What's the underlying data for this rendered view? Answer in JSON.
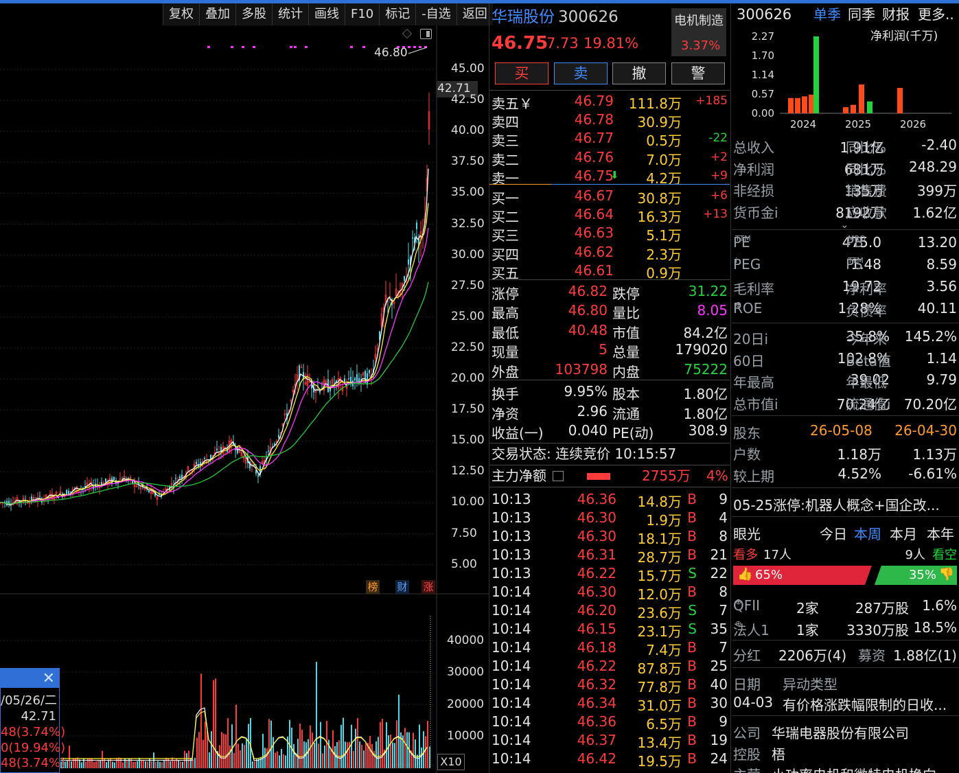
{
  "toolbar": [
    "复权",
    "叠加",
    "多股",
    "统计",
    "画线",
    "F10",
    "标记",
    "-自选",
    "返回"
  ],
  "chart": {
    "price_labels": [
      "45.00",
      "42.50",
      "40.00",
      "37.50",
      "35.00",
      "32.50",
      "30.00",
      "27.50",
      "25.00",
      "22.50",
      "20.00",
      "17.50",
      "15.00",
      "12.50",
      "10.00",
      "7.50",
      "5.00"
    ],
    "high_marker": "46.80",
    "current_price_tag": "42.71",
    "vol_labels": [
      "40000",
      "30000",
      "20000",
      "10000"
    ],
    "vol_unit": "X10",
    "badges": [
      "榜",
      "财",
      "涨"
    ],
    "tooltip": {
      "date": "/05/26/二",
      "price": "42.71",
      "l1": "48(3.74%)",
      "l2": "0(19.94%)",
      "l3": "48(3.74%)"
    }
  },
  "stock": {
    "name": "华瑞股份",
    "code": "300626",
    "price": "46.75",
    "change": "7.73",
    "pct": "19.81%",
    "sector": "电机制造",
    "sector_pct": "3.37%"
  },
  "actions": [
    "买",
    "卖",
    "撤",
    "警"
  ],
  "asks": [
    {
      "label": "卖五￥",
      "price": "46.79",
      "vol": "111.8万",
      "chg": "+185"
    },
    {
      "label": "卖四",
      "price": "46.78",
      "vol": "30.9万",
      "chg": ""
    },
    {
      "label": "卖三",
      "price": "46.77",
      "vol": "0.5万",
      "chg": "-22"
    },
    {
      "label": "卖二",
      "price": "46.76",
      "vol": "7.0万",
      "chg": "+2"
    },
    {
      "label": "卖一",
      "price": "46.75",
      "vol": "4.2万",
      "chg": "+9"
    }
  ],
  "bids": [
    {
      "label": "买一",
      "price": "46.67",
      "vol": "30.8万",
      "chg": "+6"
    },
    {
      "label": "买二",
      "price": "46.64",
      "vol": "16.3万",
      "chg": "+13"
    },
    {
      "label": "买三",
      "price": "46.63",
      "vol": "5.1万",
      "chg": ""
    },
    {
      "label": "买四",
      "price": "46.62",
      "vol": "2.3万",
      "chg": ""
    },
    {
      "label": "买五",
      "price": "46.61",
      "vol": "0.9万",
      "chg": ""
    }
  ],
  "stats": [
    {
      "k1": "涨停",
      "v1": "46.82",
      "c1": "r",
      "k2": "跌停",
      "v2": "31.22",
      "c2": "g"
    },
    {
      "k1": "最高",
      "v1": "46.80",
      "c1": "r",
      "k2": "量比",
      "v2": "8.05",
      "c2": "m"
    },
    {
      "k1": "最低",
      "v1": "40.48",
      "c1": "r",
      "k2": "市值",
      "v2": "84.2亿",
      "c2": "w"
    },
    {
      "k1": "现量",
      "v1": "5",
      "c1": "r",
      "k2": "总量",
      "v2": "179020",
      "c2": "w"
    },
    {
      "k1": "外盘",
      "v1": "103798",
      "c1": "r",
      "k2": "内盘",
      "v2": "75222",
      "c2": "g"
    }
  ],
  "stats2": [
    {
      "k1": "换手",
      "v1": "9.95%",
      "k2": "股本",
      "v2": "1.80亿"
    },
    {
      "k1": "净资",
      "v1": "2.96",
      "k2": "流通",
      "v2": "1.80亿"
    },
    {
      "k1": "收益(一)",
      "v1": "0.040",
      "k2": "PE(动)",
      "v2": "308.9"
    }
  ],
  "trade_status": "交易状态: 连续竞价 10:15:57",
  "main_flow": {
    "label": "主力净额",
    "value": "2755万",
    "pct": "4%"
  },
  "ticks": [
    {
      "t": "10:13",
      "p": "46.36",
      "v": "14.8万",
      "s": "B",
      "n": "9"
    },
    {
      "t": "10:13",
      "p": "46.30",
      "v": "1.9万",
      "s": "B",
      "n": "4"
    },
    {
      "t": "10:13",
      "p": "46.30",
      "v": "18.1万",
      "s": "B",
      "n": "8"
    },
    {
      "t": "10:13",
      "p": "46.31",
      "v": "28.7万",
      "s": "B",
      "n": "21"
    },
    {
      "t": "10:13",
      "p": "46.22",
      "v": "15.7万",
      "s": "S",
      "n": "22"
    },
    {
      "t": "10:14",
      "p": "46.30",
      "v": "12.0万",
      "s": "B",
      "n": "8"
    },
    {
      "t": "10:14",
      "p": "46.20",
      "v": "23.6万",
      "s": "S",
      "n": "7"
    },
    {
      "t": "10:14",
      "p": "46.15",
      "v": "23.1万",
      "s": "S",
      "n": "35"
    },
    {
      "t": "10:14",
      "p": "46.18",
      "v": "7.4万",
      "s": "B",
      "n": "7"
    },
    {
      "t": "10:14",
      "p": "46.22",
      "v": "87.8万",
      "s": "B",
      "n": "25"
    },
    {
      "t": "10:14",
      "p": "46.32",
      "v": "77.8万",
      "s": "B",
      "n": "40"
    },
    {
      "t": "10:14",
      "p": "46.34",
      "v": "31.0万",
      "s": "B",
      "n": "30"
    },
    {
      "t": "10:14",
      "p": "46.36",
      "v": "6.5万",
      "s": "B",
      "n": "9"
    },
    {
      "t": "10:14",
      "p": "46.37",
      "v": "13.4万",
      "s": "B",
      "n": "19"
    },
    {
      "t": "10:14",
      "p": "46.42",
      "v": "19.5万",
      "s": "B",
      "n": "24"
    }
  ],
  "fin": {
    "code": "300626",
    "tabs": [
      "单季",
      "同季",
      "财报",
      "更多.."
    ],
    "chart_title": "净利润(千万)",
    "y_labels": [
      "2.27",
      "1.70",
      "1.14",
      "0.57",
      "0.00"
    ],
    "x_labels": [
      "2024",
      "2025",
      "2026"
    ],
    "rows1": [
      {
        "k1": "总收入",
        "v1": "1.91亿",
        "k2": "同比%",
        "v2": "-2.40"
      },
      {
        "k1": "净利润",
        "v1": "681万",
        "k2": "同比%",
        "v2": "248.29"
      },
      {
        "k1": "非经损",
        "v1": "135万",
        "k2": "销售费",
        "v2": "399万"
      },
      {
        "k1": "货币金i",
        "v1": "8192万",
        "k2": "应收款",
        "v2": "1.62亿"
      }
    ],
    "expand_icon": "chevron-down",
    "rows2": [
      {
        "k1": "PE",
        "s1": "TTM",
        "v1": "475.0",
        "k2": "PB",
        "s2": "MRQ",
        "v2": "13.20"
      },
      {
        "k1": "PEG",
        "s1": "i",
        "v1": "1.48",
        "k2": "PS",
        "s2": "TTM",
        "v2": "8.59"
      },
      {
        "k1": "毛利率",
        "s1": "",
        "v1": "19.72",
        "k2": "净利率",
        "s2": "",
        "v2": "3.56"
      },
      {
        "k1": "ROE",
        "s1": "⊕",
        "v1": "1.28%",
        "k2": "负债率",
        "s2": "",
        "v2": "40.11"
      }
    ],
    "rows3": [
      {
        "k1": "20日i",
        "v1": "35.8%",
        "k2": "今年来",
        "v2": "145.2%"
      },
      {
        "k1": "60日",
        "v1": "102.8%",
        "k2": "Beta值",
        "v2": "1.14"
      },
      {
        "k1": "年最高",
        "v1": "39.02",
        "k2": "年最低",
        "v2": "9.79"
      },
      {
        "k1": "总市值i",
        "v1": "70.24亿",
        "k2": "流通值i",
        "v2": "70.20亿"
      }
    ],
    "holders": {
      "label": "股东",
      "d1": "26-05-08",
      "d2": "26-04-30",
      "r1": {
        "k": "户数",
        "a": "1.18万",
        "b": "1.13万"
      },
      "r2": {
        "k": "较上期",
        "a": "4.52%",
        "b": "-6.61%"
      }
    },
    "news": "05-25涨停:机器人概念+国企改...",
    "vision": {
      "label": "眼光",
      "tabs": [
        "今日",
        "本周",
        "本月",
        "本年"
      ],
      "bull": "看多",
      "bull_n": "17人",
      "bear_n": "9人",
      "bear": "看空",
      "bull_pct": "65%",
      "bear_pct": "35%",
      "bull_frac": 0.65
    },
    "inst": [
      {
        "k": "QFII",
        "sup": "⊕",
        "a": "2家",
        "b": "287万股",
        "c": "1.6%"
      },
      {
        "k": "法人1",
        "sup": "⊕",
        "a": "1家",
        "b": "3330万股",
        "c": "18.5%"
      }
    ],
    "dividend": {
      "k": "分红",
      "a": "2206万(4)",
      "k2": "募资",
      "b": "1.88亿(1)"
    },
    "event": {
      "h1": "日期",
      "h2": "异动类型",
      "date": "04-03",
      "text": "有价格涨跌幅限制的日收..."
    },
    "company": {
      "k": "公司",
      "v": "华瑞电器股份有限公司"
    },
    "control": {
      "k": "控股",
      "v": "梧"
    },
    "main_biz": {
      "k": "主营",
      "v": "小功率电机和微特电机换向"
    }
  },
  "colors": {
    "up": "#ff3b3b",
    "down": "#22d43c",
    "ma5": "#ffffff",
    "ma10": "#ffee33",
    "ma20": "#ff33ff",
    "ma60": "#22c83a",
    "accent": "#3d8cff"
  }
}
